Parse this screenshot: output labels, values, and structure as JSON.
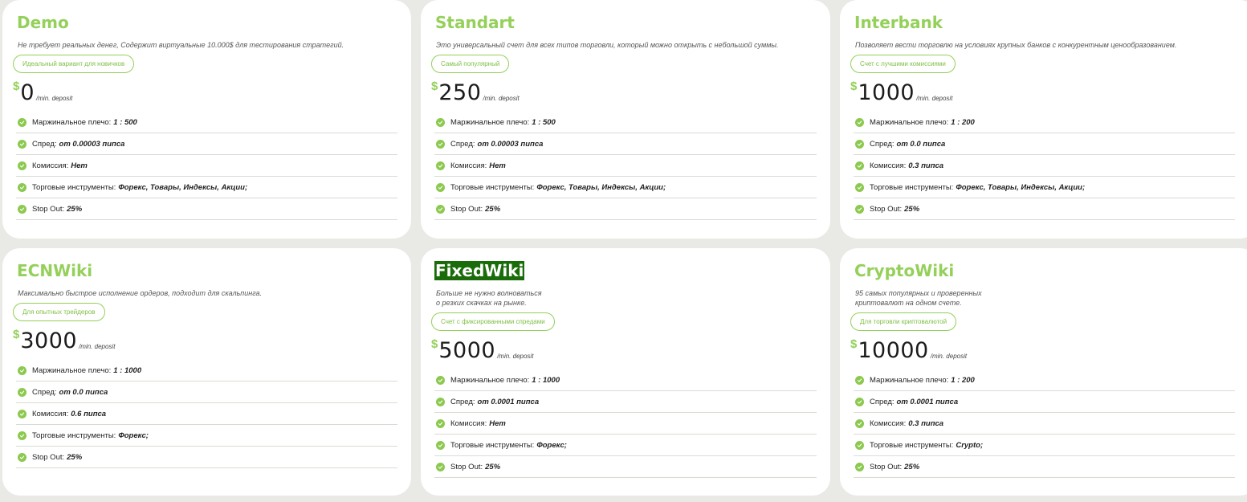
{
  "cards": [
    {
      "title": "Demo",
      "description": "Не требует реальных денег, Содержит виртуальные 10.000$ для тестирования стратегий.",
      "badge": "Идеальный вариант для новичков",
      "currency": "$",
      "amount": "0",
      "unit": "/min. deposit",
      "features": [
        {
          "label": "Маржинальное плечо:",
          "value": "1 : 500"
        },
        {
          "label": "Спред:",
          "value": "от 0.00003 пипса"
        },
        {
          "label": "Комиссия:",
          "value": "Нет"
        },
        {
          "label": "Торговые инструменты:",
          "value": "Форекс, Товары, Индексы, Акции;"
        },
        {
          "label": "Stop Out:",
          "value": "25%"
        }
      ]
    },
    {
      "title": "Standart",
      "description": "Это универсальный счет для всех типов торговли, который можно открыть с небольшой суммы.",
      "badge": "Самый популярный",
      "currency": "$",
      "amount": "250",
      "unit": "/min. deposit",
      "features": [
        {
          "label": "Маржинальное плечо:",
          "value": "1 : 500"
        },
        {
          "label": "Спред:",
          "value": "от 0.00003 пипса"
        },
        {
          "label": "Комиссия:",
          "value": "Нет"
        },
        {
          "label": "Торговые инструменты:",
          "value": "Форекс, Товары, Индексы, Акции;"
        },
        {
          "label": "Stop Out:",
          "value": "25%"
        }
      ]
    },
    {
      "title": "Interbank",
      "description": "Позволяет вести торговлю на условиях крупных банков с конкурентным ценообразованием.",
      "badge": "Счет с лучшими комиссиями",
      "currency": "$",
      "amount": "1000",
      "unit": "/min. deposit",
      "features": [
        {
          "label": "Маржинальное плечо:",
          "value": "1 : 200"
        },
        {
          "label": "Спред:",
          "value": "от 0.0 пипса"
        },
        {
          "label": "Комиссия:",
          "value": "0.3 пипса"
        },
        {
          "label": "Торговые инструменты:",
          "value": "Форекс, Товары, Индексы, Акции;"
        },
        {
          "label": "Stop Out:",
          "value": "25%"
        }
      ]
    },
    {
      "title": "ECNWiki",
      "description": "Максимально быстрое исполнение ордеров, подходит для скальпинга.",
      "badge": "Для опытных трейдеров",
      "currency": "$",
      "amount": "3000",
      "unit": "/min. deposit",
      "features": [
        {
          "label": "Маржинальное плечо:",
          "value": "1 : 1000"
        },
        {
          "label": "Спред:",
          "value": "от 0.0 пипса"
        },
        {
          "label": "Комиссия:",
          "value": "0.6 пипса"
        },
        {
          "label": "Торговые инструменты:",
          "value": "Форекс;"
        },
        {
          "label": "Stop Out:",
          "value": "25%"
        }
      ]
    },
    {
      "title": "FixedWiki",
      "description": "Больше не нужно волноваться\nо резких скачках на рынке.",
      "badge": "Счет с фиксированными спредами",
      "currency": "$",
      "amount": "5000",
      "unit": "/min. deposit",
      "features": [
        {
          "label": "Маржинальное плечо:",
          "value": "1 : 1000"
        },
        {
          "label": "Спред:",
          "value": "от 0.0001 пипса"
        },
        {
          "label": "Комиссия:",
          "value": "Нет"
        },
        {
          "label": "Торговые инструменты:",
          "value": "Форекс;"
        },
        {
          "label": "Stop Out:",
          "value": "25%"
        }
      ]
    },
    {
      "title": "CryptoWiki",
      "description": "95 самых популярных и проверенных\nкриптовалют на одном счете.",
      "badge": "Для торговли криптовалютой",
      "currency": "$",
      "amount": "10000",
      "unit": "/min. deposit",
      "features": [
        {
          "label": "Маржинальное плечо:",
          "value": "1 : 200"
        },
        {
          "label": "Спред:",
          "value": "от 0.0001 пипса"
        },
        {
          "label": "Комиссия:",
          "value": "0.3 пипса"
        },
        {
          "label": "Торговые инструменты:",
          "value": "Crypto;"
        },
        {
          "label": "Stop Out:",
          "value": "25%"
        }
      ]
    }
  ],
  "selected_title": "FixedWiki",
  "colors": {
    "accent": "#94d05a",
    "selection": "#1a6b0a",
    "background": "#e9eae6"
  },
  "icons": {
    "feature_bullet": "check-circle-icon"
  }
}
